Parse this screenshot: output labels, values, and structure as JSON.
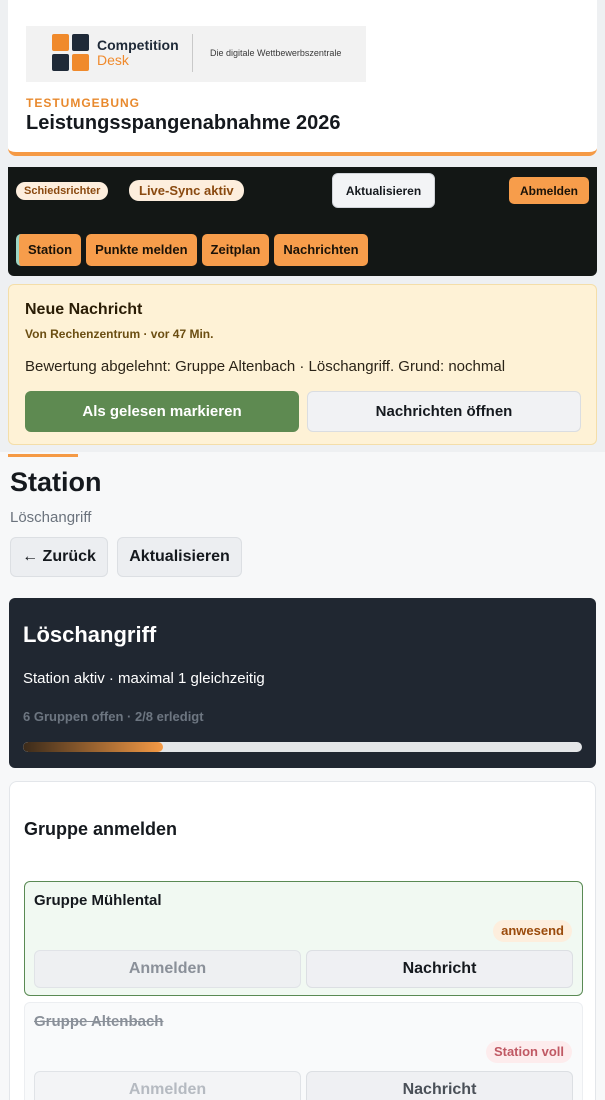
{
  "header": {
    "logo": {
      "name_line1": "Competition",
      "name_line2": "Desk",
      "tagline": "Die digitale Wettbewerbszentrale"
    },
    "environment": "TESTUMGEBUNG",
    "title": "Leistungsspangenabnahme 2026"
  },
  "navbar": {
    "role_badge": "Schiedsrichter",
    "sync_badge": "Live-Sync aktiv",
    "refresh_label": "Aktualisieren",
    "logout_label": "Abmelden",
    "tabs": [
      {
        "label": "Station",
        "active": true
      },
      {
        "label": "Punkte melden"
      },
      {
        "label": "Zeitplan"
      },
      {
        "label": "Nachrichten"
      }
    ]
  },
  "message": {
    "title": "Neue Nachricht",
    "from": "Von Rechenzentrum · vor 47 Min.",
    "text": "Bewertung abgelehnt: Gruppe Altenbach · Löschangriff. Grund: nochmal",
    "mark_read_label": "Als gelesen markieren",
    "open_label": "Nachrichten öffnen"
  },
  "station": {
    "title": "Station",
    "subtitle": "Löschangriff",
    "back_label": "← Zurück",
    "refresh_label": "Aktualisieren",
    "card": {
      "title": "Löschangriff",
      "status": "Station aktiv · maximal 1 gleichzeitig",
      "progress_text": "6 Gruppen offen · 2/8 erledigt",
      "progress_fraction": 0.25
    }
  },
  "checkin": {
    "title": "Gruppe anmelden",
    "groups": [
      {
        "name": "Gruppe Mühlental",
        "badge": "anwesend",
        "login_label": "Anmelden",
        "message_label": "Nachricht"
      },
      {
        "name": "Gruppe Altenbach",
        "badge": "Station voll",
        "login_label": "Anmelden",
        "message_label": "Nachricht"
      }
    ]
  },
  "colors": {
    "accent": "#f59a45",
    "dark": "#131715",
    "success": "#5e8a51"
  }
}
